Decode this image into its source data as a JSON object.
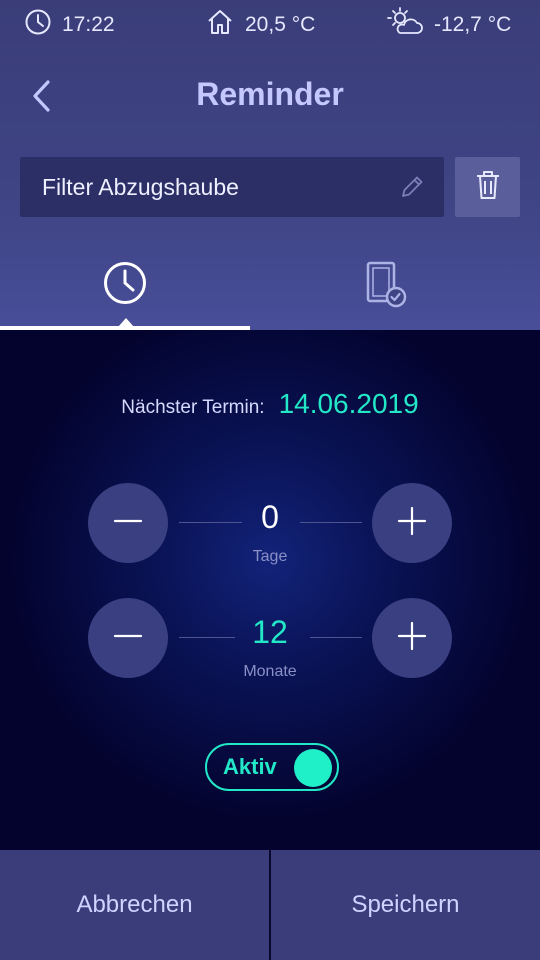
{
  "status_bar": {
    "time": "17:22",
    "indoor_temp": "20,5 °C",
    "outdoor_temp": "-12,7 °C",
    "icons": [
      "clock-icon",
      "house-icon",
      "weather-partly-cloudy-icon"
    ]
  },
  "header": {
    "title": "Reminder",
    "back_icon": "chevron-left-icon"
  },
  "reminder_name": {
    "value": "Filter Abzugshaube",
    "edit_icon": "pencil-icon",
    "delete_icon": "trash-icon"
  },
  "tabs": [
    {
      "icon": "clock-icon",
      "active": true
    },
    {
      "icon": "tablet-check-icon",
      "active": false
    }
  ],
  "schedule": {
    "next_label": "Nächster Termin:",
    "next_date": "14.06.2019",
    "days": {
      "value": "0",
      "unit": "Tage"
    },
    "months": {
      "value": "12",
      "unit": "Monate"
    }
  },
  "toggle": {
    "label": "Aktiv",
    "on": true
  },
  "footer": {
    "cancel_label": "Abbrechen",
    "save_label": "Speichern"
  },
  "colors": {
    "accent": "#22e8c7",
    "background": "#03032e",
    "header": "#3f4485",
    "button": "#3a3f82"
  }
}
